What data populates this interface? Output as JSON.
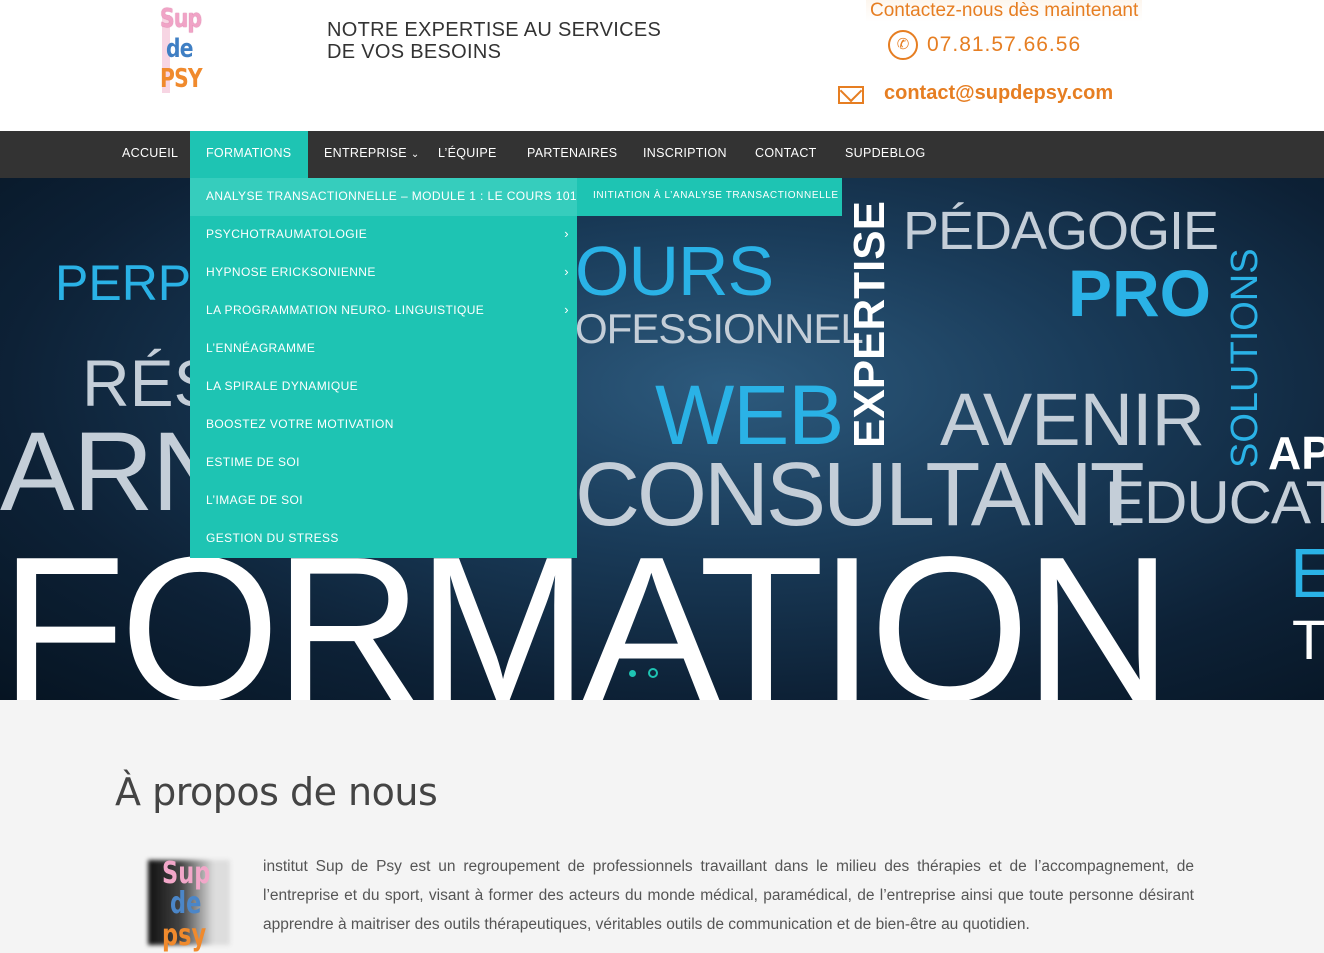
{
  "header": {
    "logo_lines": [
      "Sup",
      "de",
      "PSY"
    ],
    "tagline_line1": "NOTRE EXPERTISE AU SERVICES",
    "tagline_line2": "DE VOS BESOINS",
    "contact_title": "Contactez-nous dès maintenant",
    "phone": "07.81.57.66.56",
    "email": "contact@supdepsy.com"
  },
  "nav": {
    "items": [
      {
        "label": "ACCUEIL"
      },
      {
        "label": "FORMATIONS",
        "active": true
      },
      {
        "label": "ENTREPRISE",
        "caret": "⌄"
      },
      {
        "label": "L’ÉQUIPE"
      },
      {
        "label": "PARTENAIRES"
      },
      {
        "label": "INSCRIPTION"
      },
      {
        "label": "CONTACT"
      },
      {
        "label": "SUPDEBLOG"
      }
    ]
  },
  "dropdown": {
    "items": [
      {
        "label": "ANALYSE TRANSACTIONNELLE – MODULE 1 : LE COURS 101"
      },
      {
        "label": "PSYCHOTRAUMATOLOGIE",
        "arrow": "›"
      },
      {
        "label": "HYPNOSE ERICKSONIENNE",
        "arrow": "›"
      },
      {
        "label": "LA PROGRAMMATION NEURO- LINGUISTIQUE",
        "arrow": "›"
      },
      {
        "label": "L’ENNÉAGRAMME"
      },
      {
        "label": "LA SPIRALE DYNAMIQUE"
      },
      {
        "label": "BOOSTEZ VOTRE MOTIVATION"
      },
      {
        "label": "ESTIME DE SOI"
      },
      {
        "label": "L’IMAGE DE SOI"
      },
      {
        "label": "GESTION DU STRESS"
      }
    ],
    "submenu_label": "INITIATION À L’ANALYSE TRANSACTIONNELLE"
  },
  "hero": {
    "words": {
      "perp": "PERP",
      "ours": "OURS",
      "professionnel": "OFESSIONNEL",
      "pedagogie": "PÉDAGOGIE",
      "pro": "PRO",
      "expertise": "EXPERTISE",
      "solutions": "SOLUTIONS",
      "res": "RÉS",
      "web": "WEB",
      "avenir": "AVENIR",
      "arn": "ARN",
      "consultant": "CONSULTANT",
      "ap": "AP",
      "educat": "EDUCAT",
      "formation": "FORMATION",
      "e_right": "E",
      "t_right": "T"
    },
    "slides": 2,
    "active_slide": 1
  },
  "about": {
    "title": "À propos de nous",
    "image_lines": [
      "Sup",
      "de",
      "psy"
    ],
    "text": "institut Sup de Psy est un regroupement de professionnels travaillant dans le milieu des thérapies et de l’accompagnement, de l’entreprise et du sport, visant à former des acteurs du monde médical, paramédical, de l’entreprise ainsi que toute personne désirant apprendre à maitriser des outils thérapeutiques, véritables outils de communication et de bien-être au quotidien."
  },
  "colors": {
    "accent": "#1ec4b3",
    "nav_bg": "#333333",
    "contact_orange": "#e67e22",
    "hero_cyan": "#2ab2e6"
  }
}
